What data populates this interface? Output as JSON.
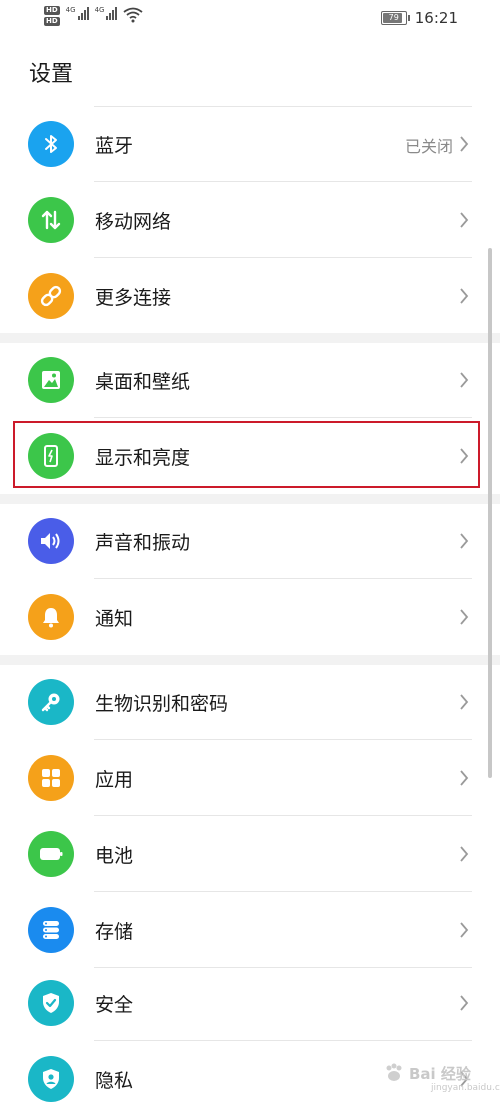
{
  "status_bar": {
    "hd1": "HD",
    "hd2": "HD",
    "net1": "4G",
    "net2": "4G",
    "battery": "79",
    "time": "16:21"
  },
  "page_title": "设置",
  "items": [
    {
      "label": "蓝牙",
      "value": "已关闭",
      "icon": "bluetooth-icon",
      "color": "#1aa3ef"
    },
    {
      "label": "移动网络",
      "value": "",
      "icon": "mobile-data-icon",
      "color": "#3cc64a"
    },
    {
      "label": "更多连接",
      "value": "",
      "icon": "link-icon",
      "color": "#f5a11a"
    },
    {
      "label": "桌面和壁纸",
      "value": "",
      "icon": "wallpaper-icon",
      "color": "#3cc64a"
    },
    {
      "label": "显示和亮度",
      "value": "",
      "icon": "display-icon",
      "color": "#3cc64a"
    },
    {
      "label": "声音和振动",
      "value": "",
      "icon": "sound-icon",
      "color": "#4a5de8"
    },
    {
      "label": "通知",
      "value": "",
      "icon": "bell-icon",
      "color": "#f5a11a"
    },
    {
      "label": "生物识别和密码",
      "value": "",
      "icon": "key-icon",
      "color": "#1ab7c7"
    },
    {
      "label": "应用",
      "value": "",
      "icon": "apps-icon",
      "color": "#f5a11a"
    },
    {
      "label": "电池",
      "value": "",
      "icon": "battery-icon",
      "color": "#3cc64a"
    },
    {
      "label": "存储",
      "value": "",
      "icon": "storage-icon",
      "color": "#1a8bef"
    },
    {
      "label": "安全",
      "value": "",
      "icon": "shield-icon",
      "color": "#1ab7c7"
    },
    {
      "label": "隐私",
      "value": "",
      "icon": "privacy-icon",
      "color": "#1ab7c7"
    }
  ],
  "watermark": {
    "text": "Bai 经验",
    "sub": "jingyan.baidu.com"
  }
}
